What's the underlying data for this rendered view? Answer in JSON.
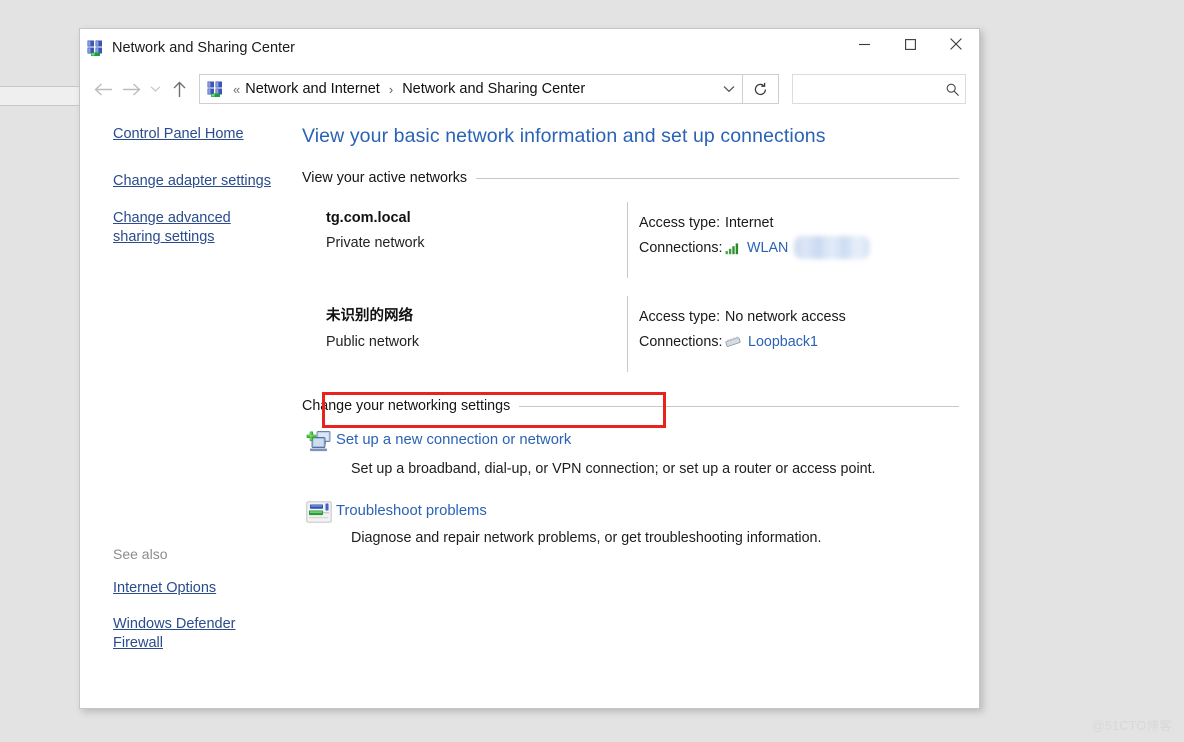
{
  "window": {
    "title": "Network and Sharing Center",
    "app_icon": "network-icon",
    "controls": {
      "minimize": "minimize-button",
      "maximize": "maximize-button",
      "close": "close-button"
    }
  },
  "navbar": {
    "back": "back-arrow",
    "forward": "forward-arrow",
    "recent": "recent-locations-chevron",
    "up": "up-arrow",
    "address_icon": "network-icon",
    "breadcrumb_prefix": "«",
    "breadcrumbs": [
      {
        "label": "Network and Internet"
      },
      {
        "label": "Network and Sharing Center"
      }
    ],
    "breadcrumb_separator": "›",
    "dropdown": "chevron-down-icon",
    "refresh": "refresh-icon",
    "search": {
      "value": "",
      "placeholder": "",
      "icon": "search-icon"
    }
  },
  "sidebar": {
    "items": [
      {
        "label": "Control Panel Home"
      },
      {
        "label": "Change adapter settings"
      },
      {
        "label": "Change advanced sharing settings"
      }
    ],
    "see_also": {
      "label": "See also",
      "items": [
        {
          "label": "Internet Options"
        },
        {
          "label": "Windows Defender Firewall"
        }
      ]
    }
  },
  "content": {
    "page_title": "View your basic network information and set up connections",
    "active_networks": {
      "heading": "View your active networks",
      "labels": {
        "access_type": "Access type:",
        "connections": "Connections:"
      },
      "rows": [
        {
          "name": "tg.com.local",
          "type": "Private network",
          "access_type": "Internet",
          "connection": "WLAN",
          "connection_icon": "wifi-signal-icon",
          "redacted": true
        },
        {
          "name": "未识别的网络",
          "type": "Public network",
          "access_type": "No network access",
          "connection": "Loopback1",
          "connection_icon": "ethernet-cable-icon",
          "redacted": false
        }
      ]
    },
    "change_settings": {
      "heading": "Change your networking settings",
      "tasks": [
        {
          "icon": "new-connection-icon",
          "link": "Set up a new connection or network",
          "description": "Set up a broadband, dial-up, or VPN connection; or set up a router or access point.",
          "highlighted": true
        },
        {
          "icon": "troubleshoot-icon",
          "link": "Troubleshoot problems",
          "description": "Diagnose and repair network problems, or get troubleshooting information.",
          "highlighted": false
        }
      ]
    }
  },
  "watermark": "@51CTO博客",
  "colors": {
    "link": "#2a62b5",
    "sidebar_link": "#2a4b8d",
    "title": "#2a62b5",
    "highlight": "#e8231e",
    "wifi_green": "#3c9a3c"
  }
}
